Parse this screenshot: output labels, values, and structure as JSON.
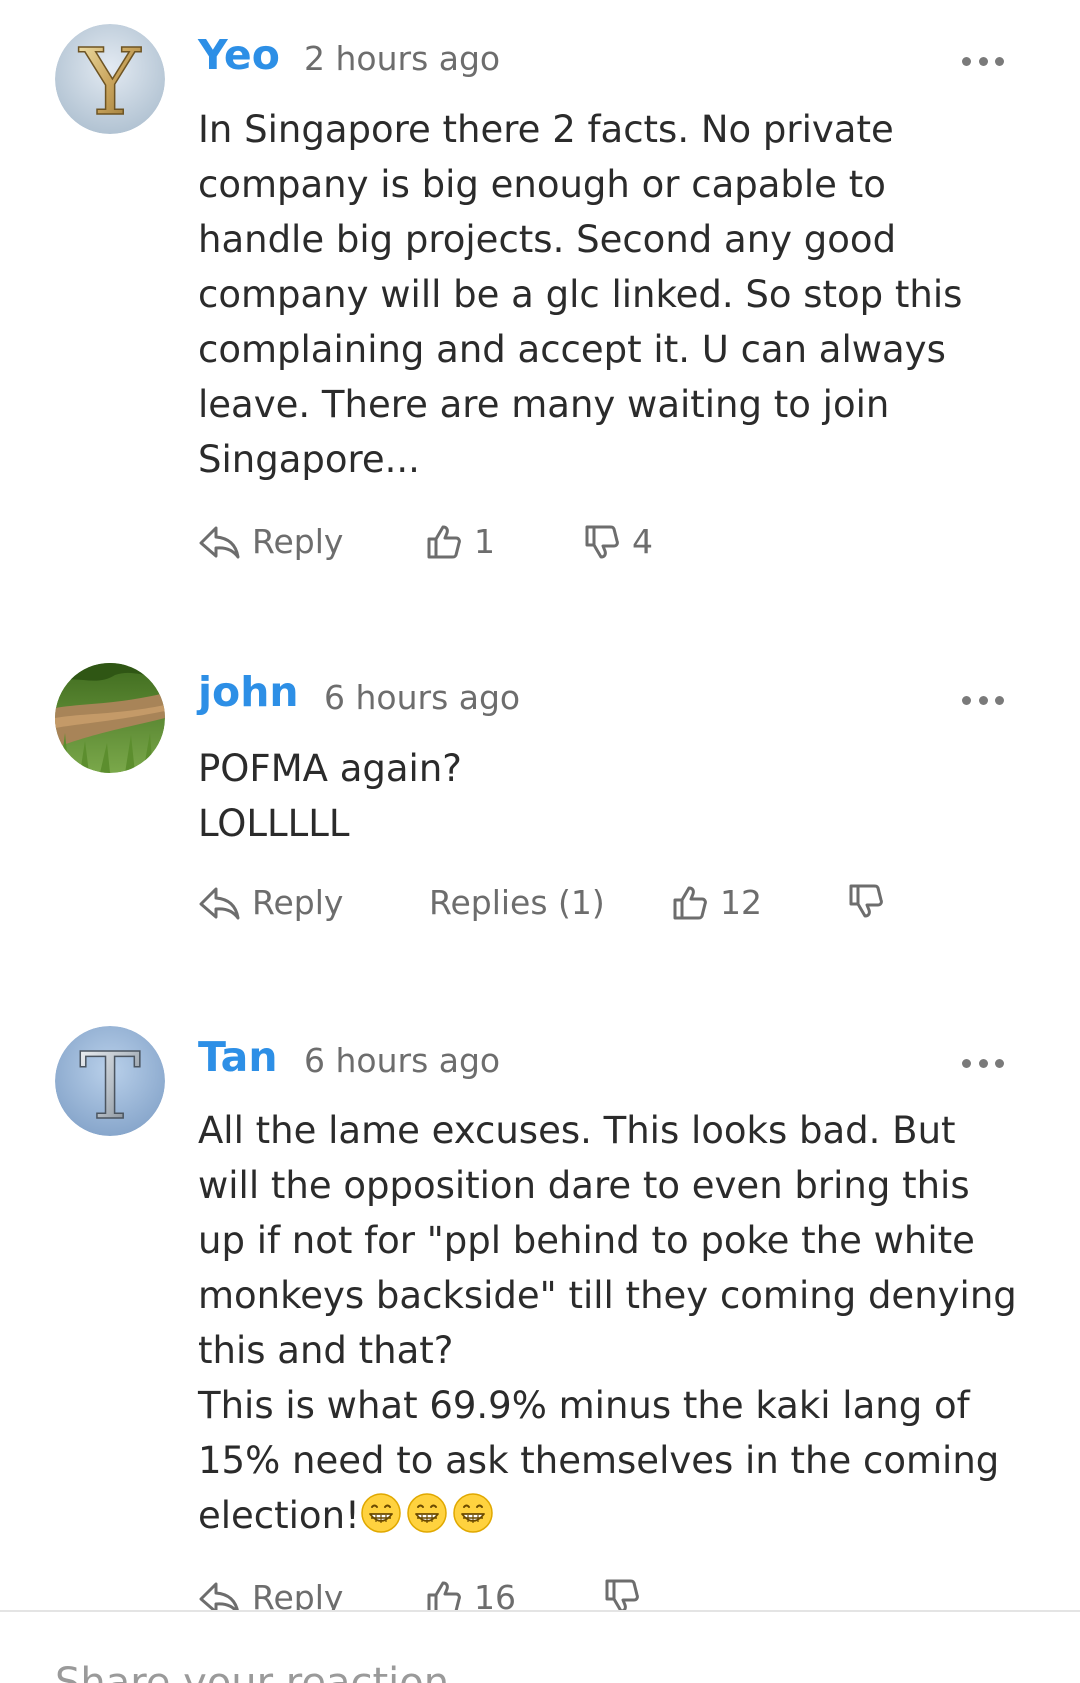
{
  "comments": [
    {
      "avatar_letter": "Y",
      "author": "Yeo",
      "time": "2 hours ago",
      "text": "In Singapore there 2 facts. No private company is big enough or capable to handle big projects. Second any good company will be a glc linked. So stop this complaining and accept it. U can always leave. There are many waiting to join Singapore...",
      "reply_label": "Reply",
      "likes": "1",
      "dislikes": "4"
    },
    {
      "author": "john",
      "time": "6 hours ago",
      "text": "POFMA again?\nLOLLLLL",
      "reply_label": "Reply",
      "replies_label": "Replies (1)",
      "likes": "12",
      "dislikes": ""
    },
    {
      "avatar_letter": "T",
      "author": "Tan",
      "time": "6 hours ago",
      "text": "All the lame excuses. This looks bad. But will the opposition dare to even bring this up if not for \"ppl behind to poke the white monkeys backside\" till they coming denying this and that?\nThis is what 69.9% minus the kaki lang of 15% need to ask themselves in the coming election!",
      "emoji_count": 3,
      "reply_label": "Reply",
      "likes": "16",
      "dislikes": ""
    }
  ],
  "reaction_placeholder": "Share your reaction",
  "colors": {
    "author": "#2d8fe6",
    "meta": "#6d6d6d",
    "text": "#2b2b2b",
    "divider": "#e4e4e4"
  },
  "icons": {
    "reply": "reply-arrow-icon",
    "like": "thumbs-up-icon",
    "dislike": "thumbs-down-icon",
    "more": "more-dots-icon",
    "emoji": "grinning-face-emoji"
  }
}
